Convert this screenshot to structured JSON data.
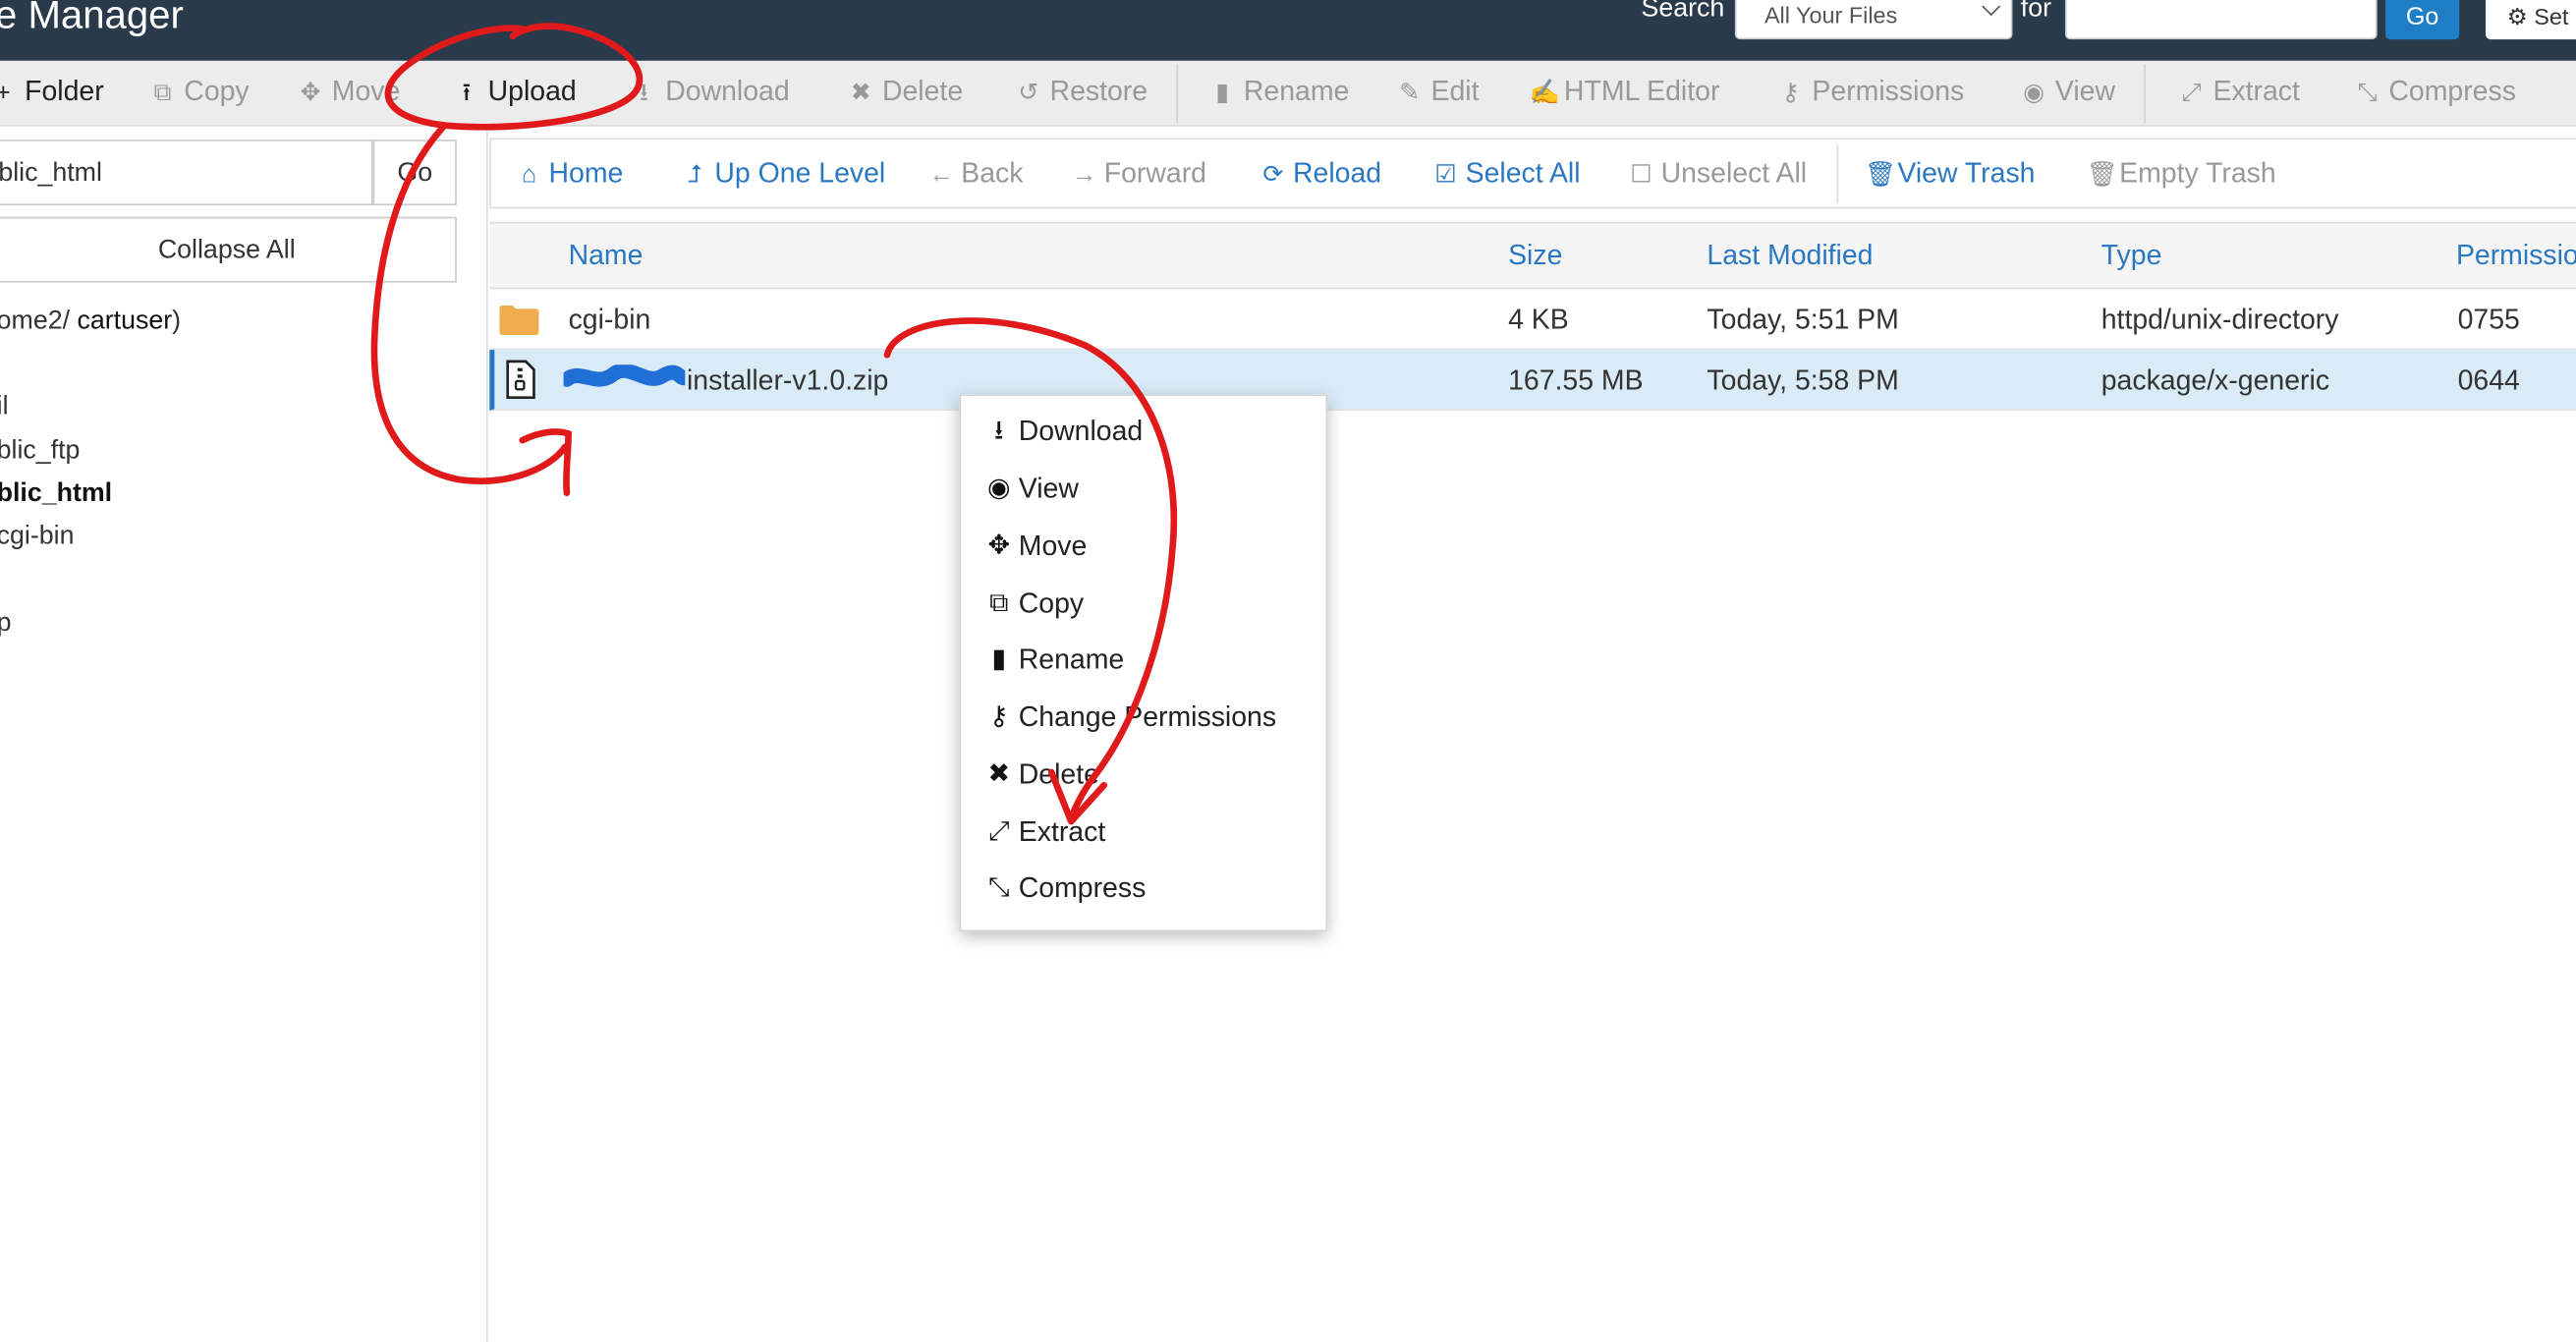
{
  "header": {
    "app_title": "e Manager",
    "search_label": "Search",
    "search_scope": "All Your Files",
    "for_label": "for",
    "search_value": "",
    "go_label": "Go",
    "settings_label": "Set"
  },
  "toolbar": {
    "items": [
      {
        "label": "Folder",
        "icon": "plus-icon",
        "active": true
      },
      {
        "label": "Copy",
        "icon": "copy-icon",
        "active": false
      },
      {
        "label": "Move",
        "icon": "move-icon",
        "active": false
      },
      {
        "label": "Upload",
        "icon": "upload-icon",
        "active": true
      },
      {
        "label": "Download",
        "icon": "download-icon",
        "active": false
      },
      {
        "label": "Delete",
        "icon": "delete-icon",
        "active": false
      },
      {
        "label": "Restore",
        "icon": "restore-icon",
        "active": false
      },
      {
        "label": "Rename",
        "icon": "file-icon",
        "active": false
      },
      {
        "label": "Edit",
        "icon": "pencil-icon",
        "active": false
      },
      {
        "label": "HTML Editor",
        "icon": "html-editor-icon",
        "active": false
      },
      {
        "label": "Permissions",
        "icon": "key-icon",
        "active": false
      },
      {
        "label": "View",
        "icon": "eye-icon",
        "active": false
      },
      {
        "label": "Extract",
        "icon": "expand-icon",
        "active": false
      },
      {
        "label": "Compress",
        "icon": "compress-icon",
        "active": false
      }
    ]
  },
  "sidebar": {
    "path_value": "blic_html",
    "path_go": "Go",
    "collapse_all": "Collapse All",
    "root_prefix": "ome2/",
    "root_user": "cartuser",
    "root_suffix": ")",
    "tree": [
      {
        "label": "il",
        "bold": false
      },
      {
        "label": "blic_ftp",
        "bold": false
      },
      {
        "label": "blic_html",
        "bold": true
      },
      {
        "label": "cgi-bin",
        "bold": false
      },
      {
        "label": "p",
        "bold": false
      }
    ]
  },
  "navbar": {
    "items": [
      {
        "label": "Home",
        "icon": "home-icon",
        "dim": false
      },
      {
        "label": "Up One Level",
        "icon": "up-level-icon",
        "dim": false
      },
      {
        "label": "Back",
        "icon": "arrow-left-icon",
        "dim": true
      },
      {
        "label": "Forward",
        "icon": "arrow-right-icon",
        "dim": true
      },
      {
        "label": "Reload",
        "icon": "reload-icon",
        "dim": false
      },
      {
        "label": "Select All",
        "icon": "checkbox-checked-icon",
        "dim": false
      },
      {
        "label": "Unselect All",
        "icon": "checkbox-empty-icon",
        "dim": true
      },
      {
        "label": "View Trash",
        "icon": "trash-icon",
        "dim": false
      },
      {
        "label": "Empty Trash",
        "icon": "trash-icon",
        "dim": true
      }
    ]
  },
  "table": {
    "columns": [
      "Name",
      "Size",
      "Last Modified",
      "Type",
      "Permissio"
    ],
    "rows": [
      {
        "icon": "folder-icon",
        "name": "cgi-bin",
        "size": "4 KB",
        "modified": "Today, 5:51 PM",
        "type": "httpd/unix-directory",
        "perms": "0755",
        "selected": false
      },
      {
        "icon": "zip-file-icon",
        "name": "installer-v1.0.zip",
        "size": "167.55 MB",
        "modified": "Today, 5:58 PM",
        "type": "package/x-generic",
        "perms": "0644",
        "selected": true
      }
    ]
  },
  "context_menu": {
    "items": [
      {
        "label": "Download",
        "icon": "download-icon"
      },
      {
        "label": "View",
        "icon": "eye-icon"
      },
      {
        "label": "Move",
        "icon": "move-icon"
      },
      {
        "label": "Copy",
        "icon": "copy-icon"
      },
      {
        "label": "Rename",
        "icon": "file-icon"
      },
      {
        "label": "Change Permissions",
        "icon": "key-icon"
      },
      {
        "label": "Delete",
        "icon": "delete-icon"
      },
      {
        "label": "Extract",
        "icon": "expand-icon"
      },
      {
        "label": "Compress",
        "icon": "compress-icon"
      }
    ]
  },
  "colors": {
    "header_bg": "#293a4a",
    "link_blue": "#2a78c2",
    "selected_row": "#d9ebf7",
    "annotation_red": "#e0191b",
    "redaction_blue": "#1f6fd6"
  }
}
